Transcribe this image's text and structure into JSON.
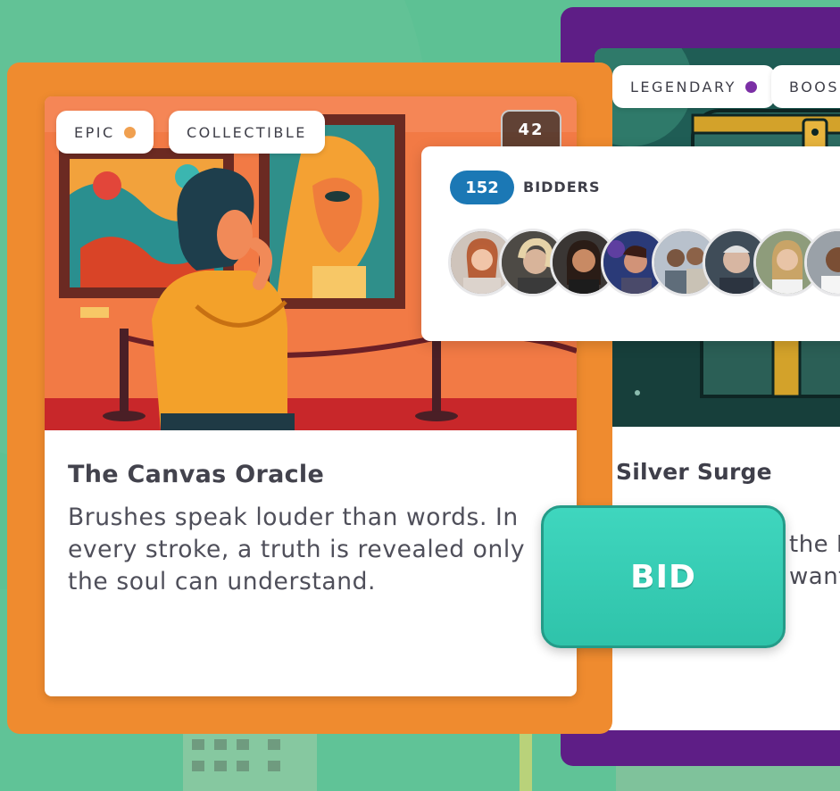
{
  "front_card": {
    "tags": [
      "EPIC",
      "COLLECTIBLE"
    ],
    "epic_dot_color": "#f0a050",
    "number_badge": "42",
    "title": "The Canvas Oracle",
    "description": "Brushes speak louder than words. In every stroke, a truth is revealed only the soul can understand.",
    "color": "#ef8b2f"
  },
  "back_card": {
    "tags": [
      "LEGENDARY",
      "BOOS"
    ],
    "legendary_dot_color": "#7b2fa5",
    "title": "Silver Surge",
    "description_fragment": "the F want",
    "color": "#5e1e86"
  },
  "bidders": {
    "count": "152",
    "label": "BIDDERS",
    "count_badge_color": "#1b78b5",
    "avatar_count": 8
  },
  "bid_button": {
    "label": "BID",
    "color": "#3ccfb6"
  }
}
